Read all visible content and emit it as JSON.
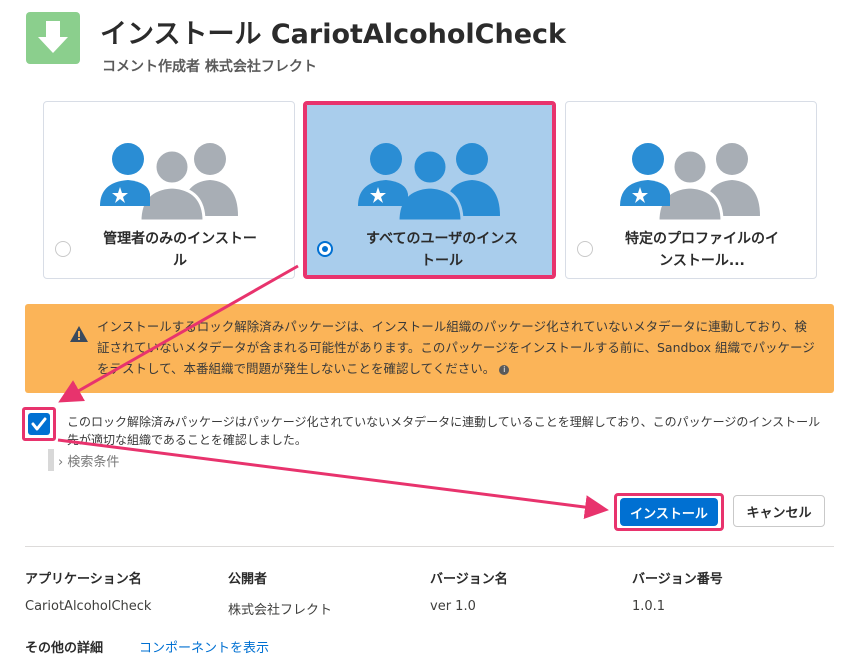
{
  "header": {
    "title": "インストール CariotAlcoholCheck",
    "subtitle": "コメント作成者 株式会社フレクト",
    "icon": "download-icon"
  },
  "install_options": [
    {
      "label_line1": "管理者のみのインストー",
      "label_line2": "ル",
      "selected": false
    },
    {
      "label_line1": "すべてのユーザのインス",
      "label_line2": "トール",
      "selected": true
    },
    {
      "label_line1": "特定のプロファイルのイ",
      "label_line2": "ンストール...",
      "selected": false
    }
  ],
  "warning": {
    "text": "インストールするロック解除済みパッケージは、インストール組織のパッケージ化されていないメタデータに連動しており、検証されていないメタデータが含まれる可能性があります。このパッケージをインストールする前に、Sandbox 組織でパッケージをテストして、本番組織で問題が発生しないことを確認してください。",
    "icon": "warning-icon"
  },
  "acknowledge": {
    "checked": true,
    "text": "このロック解除済みパッケージはパッケージ化されていないメタデータに連動していることを理解しており、このパッケージのインストール先が適切な組織であることを確認しました。"
  },
  "filter": {
    "label": "検索条件"
  },
  "buttons": {
    "install": "インストール",
    "cancel": "キャンセル"
  },
  "details": {
    "headers": [
      "アプリケーション名",
      "公開者",
      "バージョン名",
      "バージョン番号"
    ],
    "values": [
      "CariotAlcoholCheck",
      "株式会社フレクト",
      "ver 1.0",
      "1.0.1"
    ],
    "more_label": "その他の詳細",
    "more_link": "コンポーネントを表示"
  },
  "colors": {
    "accent": "#0070d2",
    "highlight": "#e8336d",
    "warning": "#fbb458",
    "selected_bg": "#a9cdec",
    "user_blue": "#2a8dd4",
    "user_gray": "#a8aeb5"
  }
}
